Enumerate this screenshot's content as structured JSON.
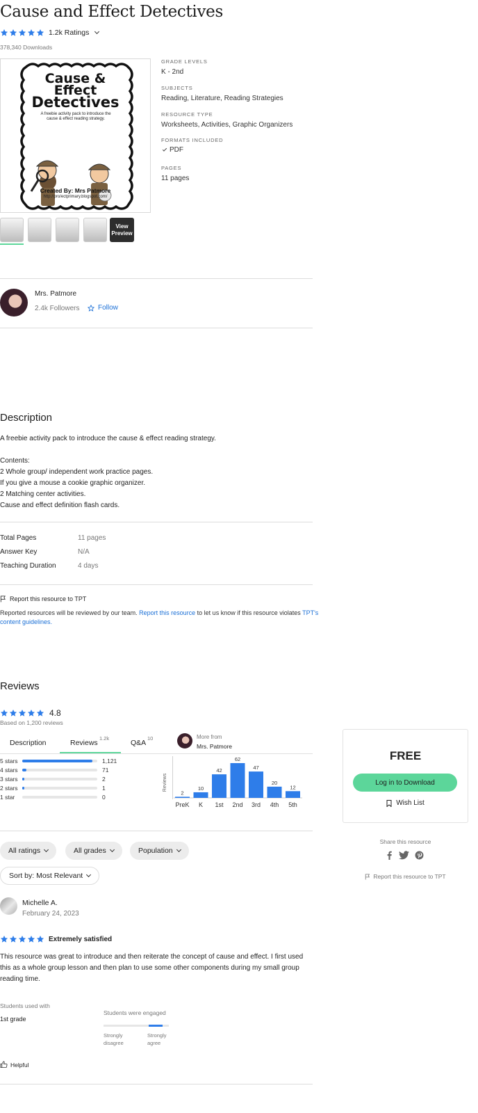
{
  "product": {
    "title": "Cause and Effect Detectives",
    "ratings_count": "1.2k Ratings",
    "downloads": "378,340 Downloads",
    "cover": {
      "line1": "Cause &",
      "line2": "Effect",
      "line3": "Detectives",
      "tagline": "A freebie activity pack to introduce the cause & effect reading strategy.",
      "created_by": "Created By: Mrs Patmore",
      "blog": "http://pro/ectprimary.blogspot.com/"
    },
    "details": [
      {
        "label": "GRADE LEVELS",
        "value": "K - 2nd"
      },
      {
        "label": "SUBJECTS",
        "value": "Reading, Literature, Reading Strategies"
      },
      {
        "label": "RESOURCE TYPE",
        "value": "Worksheets, Activities, Graphic Organizers"
      },
      {
        "label": "FORMATS INCLUDED",
        "value": "PDF"
      },
      {
        "label": "PAGES",
        "value": "11 pages"
      }
    ],
    "view_preview": "View Preview"
  },
  "seller": {
    "name": "Mrs. Patmore",
    "followers": "2.4k Followers",
    "follow": "Follow"
  },
  "description": {
    "heading": "Description",
    "intro": "A freebie activity pack to introduce the cause & effect reading strategy.",
    "contents_label": "Contents:",
    "items": [
      "2 Whole group/ independent work practice pages.",
      "If you give a mouse a cookie graphic organizer.",
      "2 Matching center activities.",
      "Cause and effect definition flash cards."
    ]
  },
  "specs": [
    {
      "label": "Total Pages",
      "value": "11 pages"
    },
    {
      "label": "Answer Key",
      "value": "N/A"
    },
    {
      "label": "Teaching Duration",
      "value": "4 days"
    }
  ],
  "report": {
    "title": "Report this resource to TPT",
    "text_before": "Reported resources will be reviewed by our team.",
    "link": "Report this resource",
    "text_after": "to let us know if this resource violates",
    "guidelines": "TPT's content guidelines."
  },
  "reviews": {
    "heading": "Reviews",
    "average": "4.8",
    "based_on": "Based on 1,200 reviews",
    "tabs": [
      {
        "label": "Description",
        "count": ""
      },
      {
        "label": "Reviews",
        "count": "1.2k"
      },
      {
        "label": "Q&A",
        "count": "10"
      }
    ],
    "more_from": "More from",
    "more_from_name": "Mrs. Patmore",
    "star_breakdown": [
      {
        "label": "5 stars",
        "count": "1,121",
        "fraction": 0.934
      },
      {
        "label": "4 stars",
        "count": "71",
        "fraction": 0.059
      },
      {
        "label": "3 stars",
        "count": "2",
        "fraction": 0.002
      },
      {
        "label": "2 stars",
        "count": "1",
        "fraction": 0.001
      },
      {
        "label": "1 star",
        "count": "0",
        "fraction": 0
      }
    ],
    "filters": [
      "All ratings",
      "All grades",
      "Population"
    ],
    "sort": "Sort by: Most Relevant"
  },
  "chart_data": {
    "type": "bar",
    "ylabel": "Reviews",
    "categories": [
      "PreK",
      "K",
      "1st",
      "2nd",
      "3rd",
      "4th",
      "5th"
    ],
    "values": [
      2,
      10,
      42,
      62,
      47,
      20,
      12
    ]
  },
  "review": {
    "author": "Michelle A.",
    "date": "February 24, 2023",
    "rating_label": "Extremely satisfied",
    "body": "This resource was great to introduce and then reiterate the concept of cause and effect. I first used this as a whole group lesson and then plan to use some other components during my small group reading time.",
    "used_with_label": "Students used with",
    "used_with_value": "1st grade",
    "engaged_label": "Students were engaged",
    "scale_left": "Strongly disagree",
    "scale_right": "Strongly agree",
    "engaged_level": 0.9,
    "helpful": "Helpful"
  },
  "purchase": {
    "price": "FREE",
    "login_button": "Log in to Download",
    "wish_list": "Wish List",
    "share_label": "Share this resource",
    "report": "Report this resource to TPT"
  },
  "colors": {
    "star": "#2e7de9",
    "link": "#1a6fd6",
    "primary_button": "#5cd69a",
    "bar": "#2e7de9"
  }
}
